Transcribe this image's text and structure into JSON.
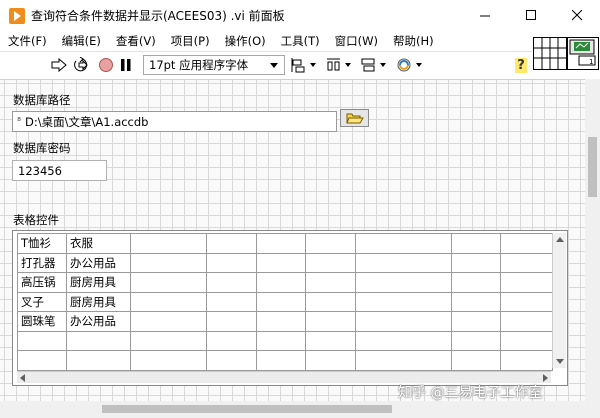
{
  "window": {
    "title": "查询符合条件数据并显示(ACEES03) .vi 前面板"
  },
  "menu": {
    "items": [
      "文件(F)",
      "编辑(E)",
      "查看(V)",
      "项目(P)",
      "操作(O)",
      "工具(T)",
      "窗口(W)",
      "帮助(H)"
    ]
  },
  "toolbar": {
    "font_label": "17pt 应用程序字体",
    "icons": [
      "run-arrow-icon",
      "run-continuous-icon",
      "abort-icon",
      "pause-icon",
      "align-icon",
      "distribute-icon",
      "resize-icon",
      "reorder-icon",
      "help-icon"
    ]
  },
  "panel": {
    "db_path_label": "数据库路径",
    "db_path_value": "D:\\桌面\\文章\\A1.accdb",
    "db_pwd_label": "数据库密码",
    "db_pwd_value": "123456",
    "table_label": "表格控件"
  },
  "table": {
    "rows": [
      [
        "T恤衫",
        "衣服",
        "",
        "",
        "",
        "",
        "",
        "",
        ""
      ],
      [
        "打孔器",
        "办公用品",
        "",
        "",
        "",
        "",
        "",
        "",
        ""
      ],
      [
        "高压锅",
        "厨房用具",
        "",
        "",
        "",
        "",
        "",
        "",
        ""
      ],
      [
        "叉子",
        "厨房用具",
        "",
        "",
        "",
        "",
        "",
        "",
        ""
      ],
      [
        "圆珠笔",
        "办公用品",
        "",
        "",
        "",
        "",
        "",
        "",
        ""
      ],
      [
        "",
        "",
        "",
        "",
        "",
        "",
        "",
        "",
        ""
      ],
      [
        "",
        "",
        "",
        "",
        "",
        "",
        "",
        "",
        ""
      ]
    ]
  },
  "watermark": "知乎 @三易电子工作室",
  "colors": {
    "app_icon": "#f08c1a",
    "grid": "#d9d9d9"
  }
}
